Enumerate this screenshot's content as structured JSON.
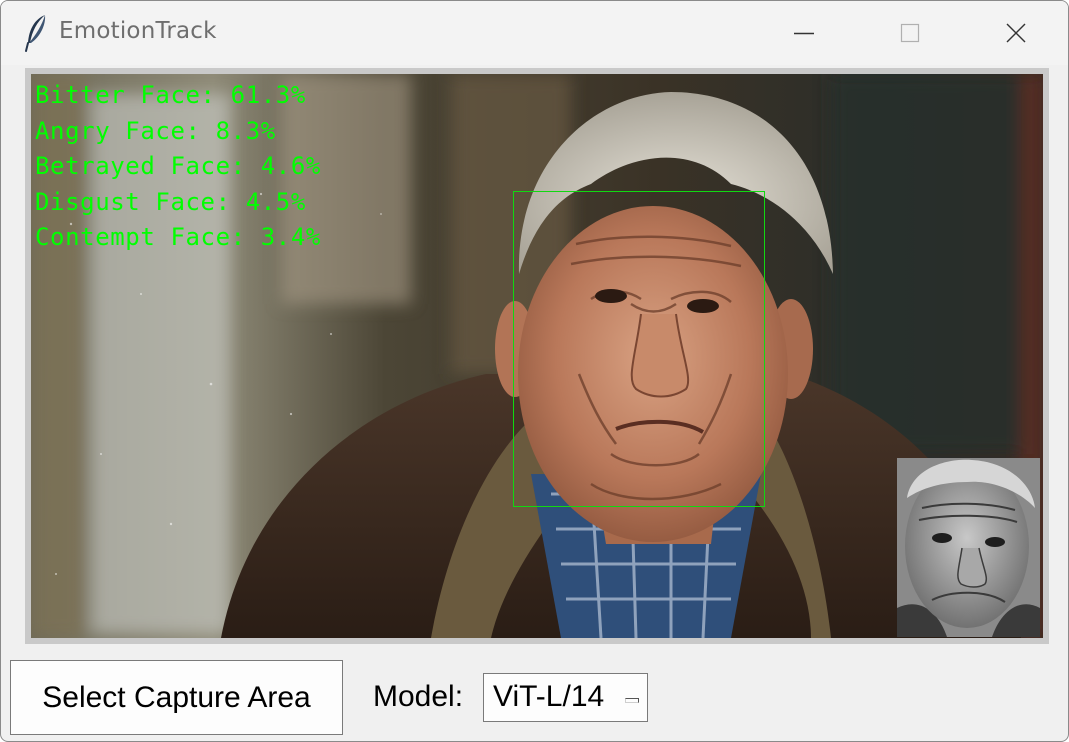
{
  "window": {
    "title": "EmotionTrack",
    "app_icon": "feather-icon",
    "controls": {
      "minimize_icon": "minimize-icon",
      "maximize_icon": "maximize-icon",
      "close_icon": "close-icon"
    }
  },
  "analysis": {
    "overlay_color": "#00ff00",
    "emotions": [
      {
        "text": "Bitter Face: 61.3%"
      },
      {
        "text": "Angry Face: 8.3%"
      },
      {
        "text": "Betrayed Face: 4.6%"
      },
      {
        "text": "Disgust Face: 4.5%"
      },
      {
        "text": "Contempt Face: 3.4%"
      }
    ]
  },
  "controls": {
    "capture_button_label": "Select Capture Area",
    "model_label": "Model:",
    "model_value": "ViT-L/14"
  }
}
